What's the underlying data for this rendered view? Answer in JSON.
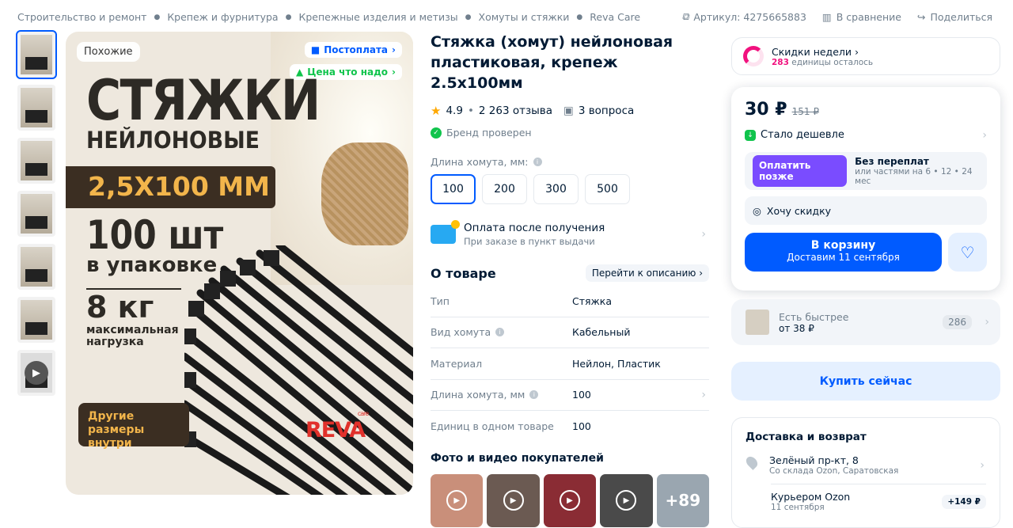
{
  "breadcrumbs": [
    "Строительство и ремонт",
    "Крепеж и фурнитура",
    "Крепежные изделия и метизы",
    "Хомуты и стяжки",
    "Reva Care"
  ],
  "topright": {
    "article": "Артикул: 4275665883",
    "compare": "В сравнение",
    "share": "Поделиться"
  },
  "gallery": {
    "similar_badge": "Похожие",
    "tag_postpay": "Постоплата",
    "tag_price": "Цена что надо",
    "text_line1": "СТЯЖКИ",
    "text_line2": "НЕЙЛОНОВЫЕ",
    "size": "2,5Х100 ММ",
    "qty": "100 шт",
    "qty_sub": "в упаковке",
    "weight": "8 кг",
    "weight_sub": "максимальная нагрузка",
    "other_sizes": "Другие размеры внутри",
    "logo": "REVA",
    "logo_sub": "care"
  },
  "product": {
    "title": "Стяжка (хомут) нейлоновая пластиковая, крепеж 2.5х100мм",
    "rating": "4.9",
    "reviews": "2 263 отзыва",
    "questions": "3 вопроса",
    "brand_verified": "Бренд проверен",
    "length_label": "Длина хомута, мм:",
    "lengths": [
      "100",
      "200",
      "300",
      "500"
    ],
    "payment_title": "Оплата после получения",
    "payment_sub": "При заказе в пункт выдачи",
    "about_title": "О товаре",
    "about_link": "Перейти к описанию",
    "specs": [
      {
        "k": "Тип",
        "v": "Стяжка"
      },
      {
        "k": "Вид хомута",
        "v": "Кабельный"
      },
      {
        "k": "Материал",
        "v": "Нейлон, Пластик"
      },
      {
        "k": "Длина хомута, мм",
        "v": "100"
      },
      {
        "k": "Единиц в одном товаре",
        "v": "100"
      }
    ],
    "photos_title": "Фото и видео покупателей",
    "photos_more": "+89"
  },
  "sidebar": {
    "week_title": "Скидки недели",
    "week_count": "283",
    "week_sub": " единицы осталось",
    "price": "30 ₽",
    "old_price": "151 ₽",
    "cheaper": "Стало дешевле",
    "pay_later_btn": "Оплатить позже",
    "pay_later_title": "Без переплат",
    "pay_later_sub": "или частями на 6 • 12 • 24 мес",
    "want_discount": "Хочу скидку",
    "cart": "В корзину",
    "cart_sub": "Доставим 11 сентября",
    "faster_title": "Есть быстрее",
    "faster_price": "от 38 ₽",
    "faster_count": "286",
    "buy_now": "Купить сейчас",
    "delivery_title": "Доставка и возврат",
    "address": "Зелёный пр-кт, 8",
    "address_sub": "Со склада Ozon, Саратовская",
    "courier": "Курьером Ozon",
    "courier_sub": "11 сентября",
    "courier_fee": "+149 ₽"
  },
  "colors": {
    "accent": "#005bff",
    "green": "#10c44c",
    "pink": "#f1117e",
    "purple": "#7a4cff"
  }
}
